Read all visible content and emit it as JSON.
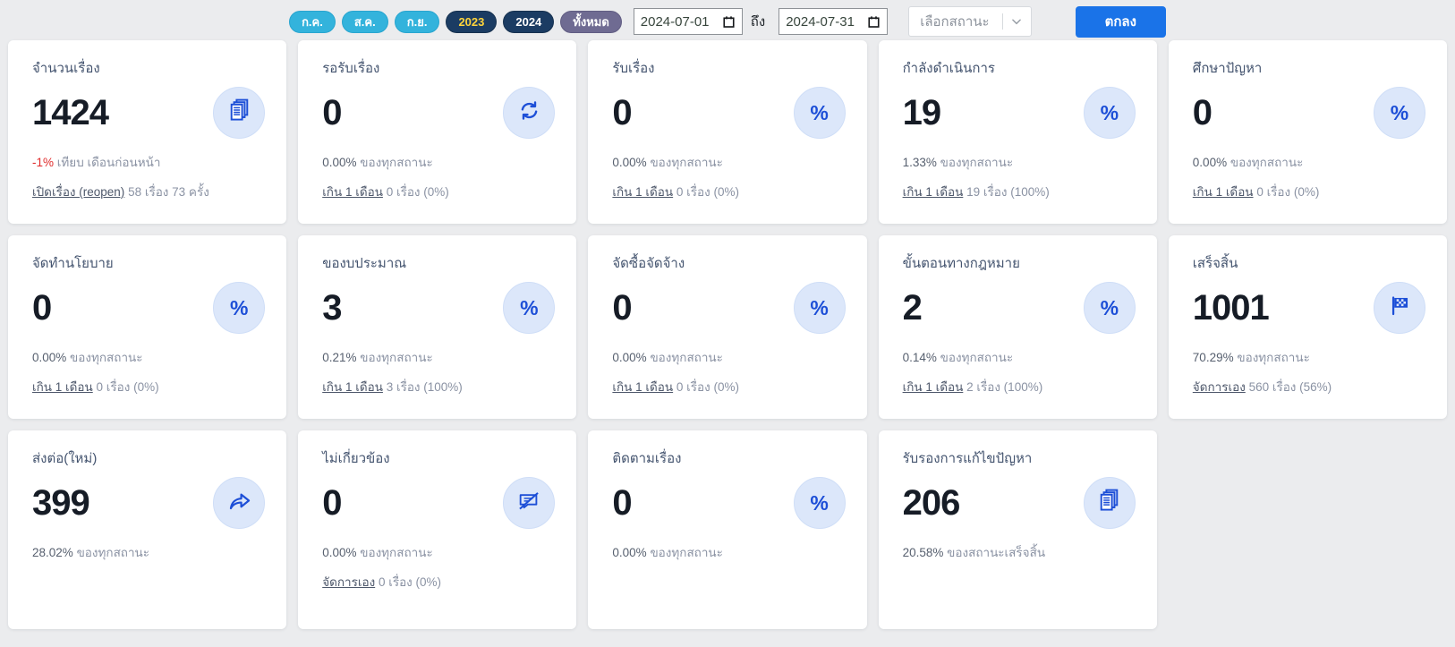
{
  "toolbar": {
    "month_pills": [
      "ก.ค.",
      "ส.ค.",
      "ก.ย."
    ],
    "year_pills": [
      "2023",
      "2024"
    ],
    "all_pill": "ทั้งหมด",
    "date_from": "2024-07-01",
    "date_to_label": "ถึง",
    "date_to": "2024-07-31",
    "status_select_placeholder": "เลือกสถานะ",
    "submit_label": "ตกลง"
  },
  "colors": {
    "accent_blue": "#1a73e8",
    "icon_blue": "#1d4fd7",
    "icon_circle_bg": "#dce7fa",
    "negative_red": "#e02b2b",
    "pill_cyan": "#33b3dc",
    "pill_navy": "#1b3c63",
    "pill_purple": "#6f6b92",
    "pill_2023_text": "#ffd43b",
    "page_bg": "#ebecee"
  },
  "cards": [
    {
      "title": "จำนวนเรื่อง",
      "value": "1424",
      "icon": "documents-icon",
      "sub_value": "-1%",
      "sub_value_color": "#e02b2b",
      "sub_text": "เทียบ เดือนก่อนหน้า",
      "link_label": "เปิดเรื่อง (reopen)",
      "link_suffix": "58 เรื่อง 73 ครั้ง"
    },
    {
      "title": "รอรับเรื่อง",
      "value": "0",
      "icon": "sync-icon",
      "sub_value": "0.00%",
      "sub_text": "ของทุกสถานะ",
      "link_label": "เกิน 1 เดือน",
      "link_suffix": "0 เรื่อง (0%)"
    },
    {
      "title": "รับเรื่อง",
      "value": "0",
      "icon": "percent-icon",
      "sub_value": "0.00%",
      "sub_text": "ของทุกสถานะ",
      "link_label": "เกิน 1 เดือน",
      "link_suffix": "0 เรื่อง (0%)"
    },
    {
      "title": "กำลังดำเนินการ",
      "value": "19",
      "icon": "percent-icon",
      "sub_value": "1.33%",
      "sub_text": "ของทุกสถานะ",
      "link_label": "เกิน 1 เดือน",
      "link_suffix": "19 เรื่อง (100%)"
    },
    {
      "title": "ศึกษาปัญหา",
      "value": "0",
      "icon": "percent-icon",
      "sub_value": "0.00%",
      "sub_text": "ของทุกสถานะ",
      "link_label": "เกิน 1 เดือน",
      "link_suffix": "0 เรื่อง (0%)"
    },
    {
      "title": "จัดทำนโยบาย",
      "value": "0",
      "icon": "percent-icon",
      "sub_value": "0.00%",
      "sub_text": "ของทุกสถานะ",
      "link_label": "เกิน 1 เดือน",
      "link_suffix": "0 เรื่อง (0%)"
    },
    {
      "title": "ของบประมาณ",
      "value": "3",
      "icon": "percent-icon",
      "sub_value": "0.21%",
      "sub_text": "ของทุกสถานะ",
      "link_label": "เกิน 1 เดือน",
      "link_suffix": "3 เรื่อง (100%)"
    },
    {
      "title": "จัดซื้อจัดจ้าง",
      "value": "0",
      "icon": "percent-icon",
      "sub_value": "0.00%",
      "sub_text": "ของทุกสถานะ",
      "link_label": "เกิน 1 เดือน",
      "link_suffix": "0 เรื่อง (0%)"
    },
    {
      "title": "ขั้นตอนทางกฎหมาย",
      "value": "2",
      "icon": "percent-icon",
      "sub_value": "0.14%",
      "sub_text": "ของทุกสถานะ",
      "link_label": "เกิน 1 เดือน",
      "link_suffix": "2 เรื่อง (100%)"
    },
    {
      "title": "เสร็จสิ้น",
      "value": "1001",
      "icon": "checkered-flag-icon",
      "sub_value": "70.29%",
      "sub_text": "ของทุกสถานะ",
      "link_label": "จัดการเอง",
      "link_suffix": "560 เรื่อง (56%)"
    },
    {
      "title": "ส่งต่อ(ใหม่)",
      "value": "399",
      "icon": "forward-arrow-icon",
      "sub_value": "28.02%",
      "sub_text": "ของทุกสถานะ"
    },
    {
      "title": "ไม่เกี่ยวข้อง",
      "value": "0",
      "icon": "chat-slash-icon",
      "sub_value": "0.00%",
      "sub_text": "ของทุกสถานะ",
      "link_label": "จัดการเอง",
      "link_suffix": "0 เรื่อง (0%)"
    },
    {
      "title": "ติดตามเรื่อง",
      "value": "0",
      "icon": "percent-icon",
      "sub_value": "0.00%",
      "sub_text": "ของทุกสถานะ"
    },
    {
      "title": "รับรองการแก้ไขปัญหา",
      "value": "206",
      "icon": "documents-icon",
      "sub_value": "20.58%",
      "sub_text": "ของสถานะเสร็จสิ้น"
    }
  ]
}
